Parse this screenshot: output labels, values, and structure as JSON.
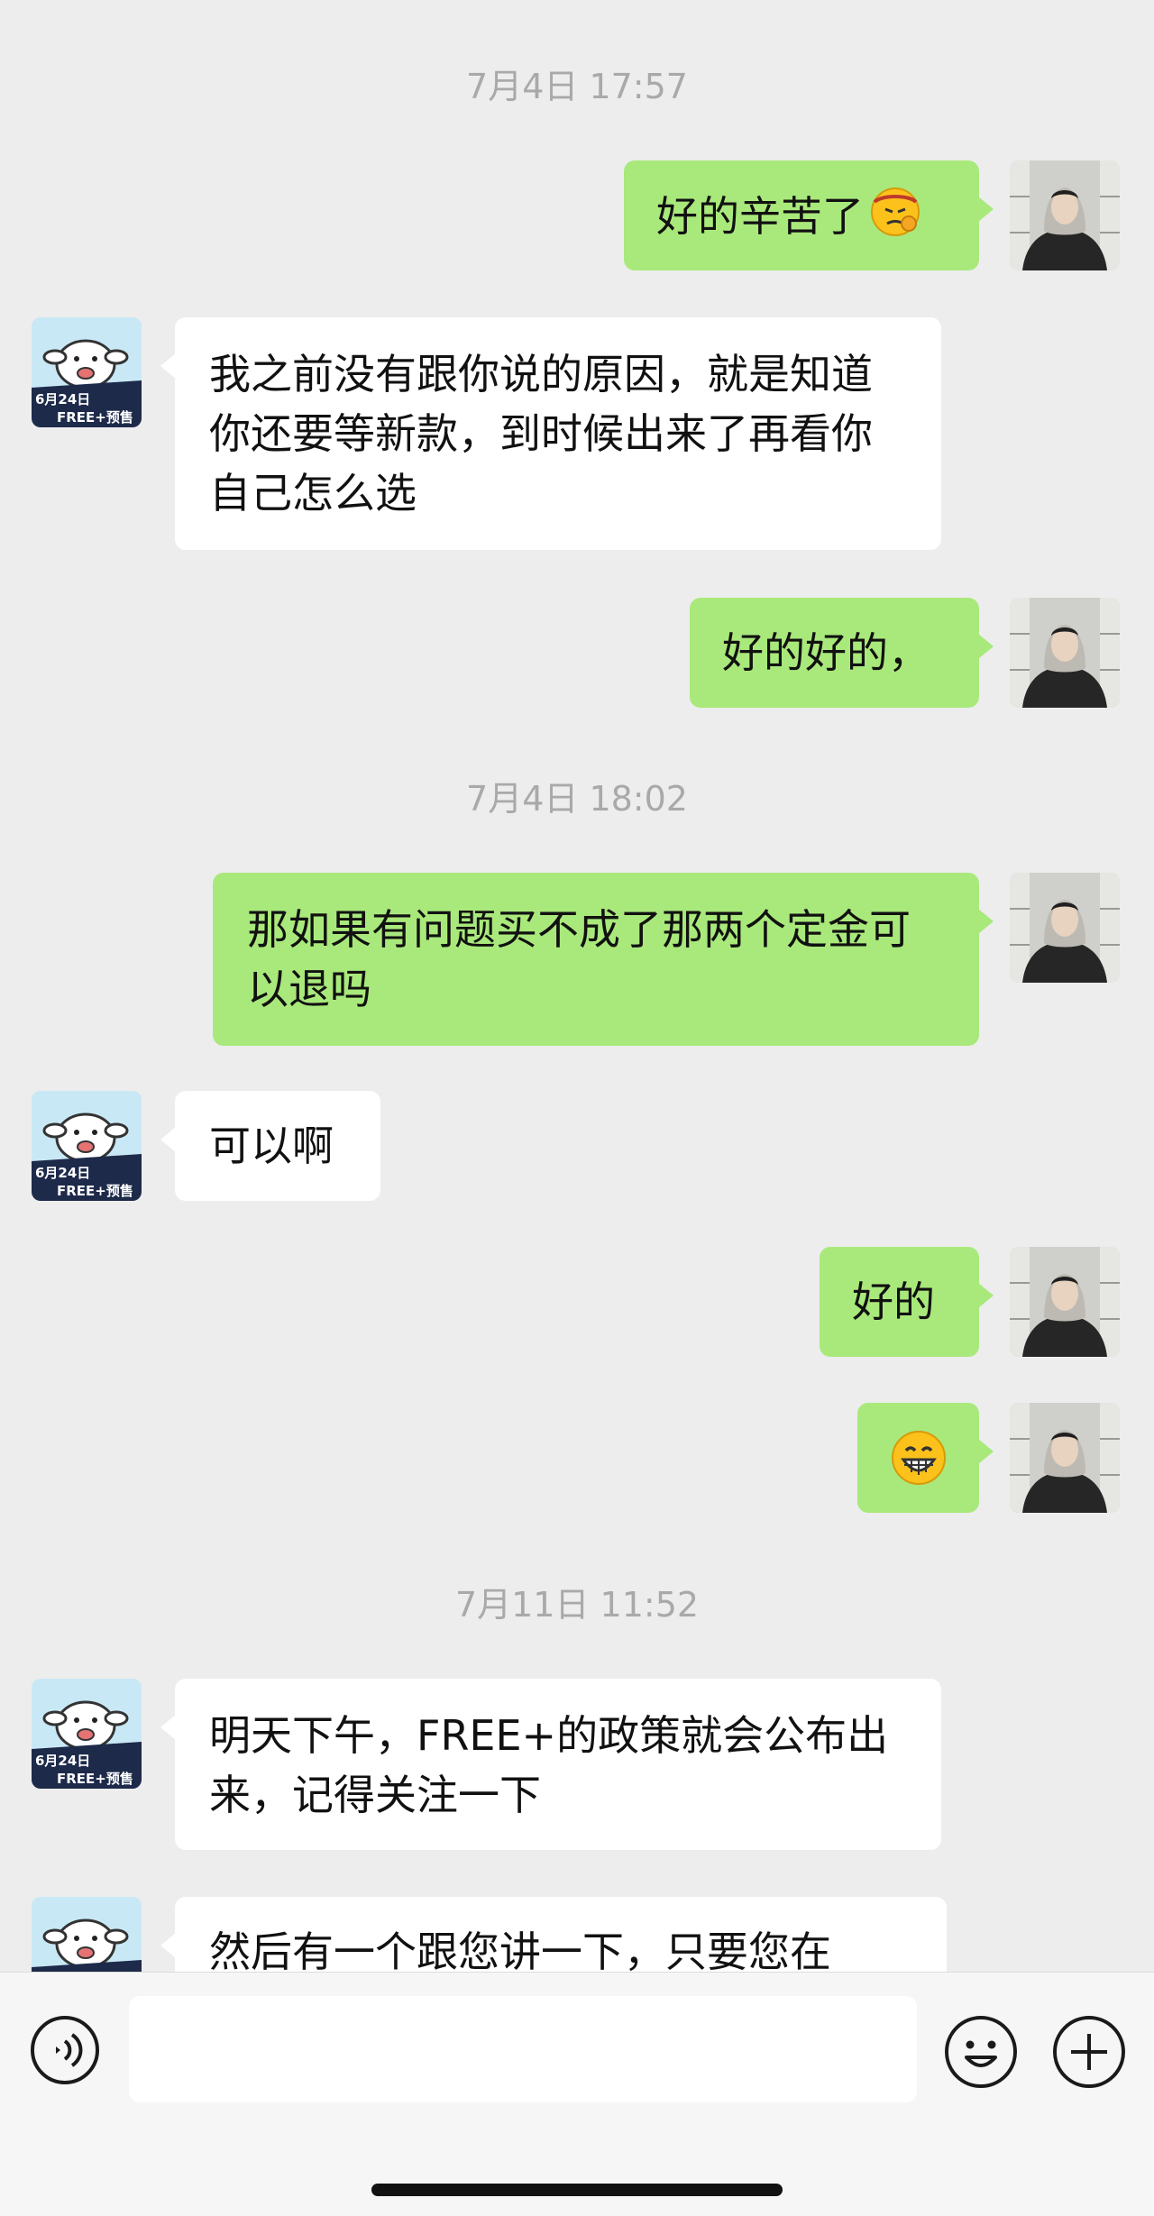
{
  "messages": {
    "t1": "7月4日 17:57",
    "m1": "好的辛苦了",
    "m2": "我之前没有跟你说的原因，就是知道你还要等新款，到时候出来了再看你自己怎么选",
    "m3": "好的好的，",
    "t2": "7月4日 18:02",
    "m4": "那如果有问题买不成了那两个定金可以退吗",
    "m5": "可以啊",
    "m6": "好的",
    "m7_emoji": "grinning-face-emoji",
    "t3": "7月11日 11:52",
    "m8": "明天下午，FREE+的政策就会公布出来，记得关注一下",
    "m9": "然后有一个跟您讲一下，只要您在"
  },
  "contact_avatar": {
    "date_text": "6月24日",
    "badge_text": "FREE+预售"
  },
  "colors": {
    "outgoing_bubble": "#a9e97b",
    "incoming_bubble": "#ffffff",
    "chat_background": "#ededed"
  },
  "icons": {
    "voice": "voice-icon",
    "emoji": "emoji-icon",
    "plus": "plus-icon"
  }
}
